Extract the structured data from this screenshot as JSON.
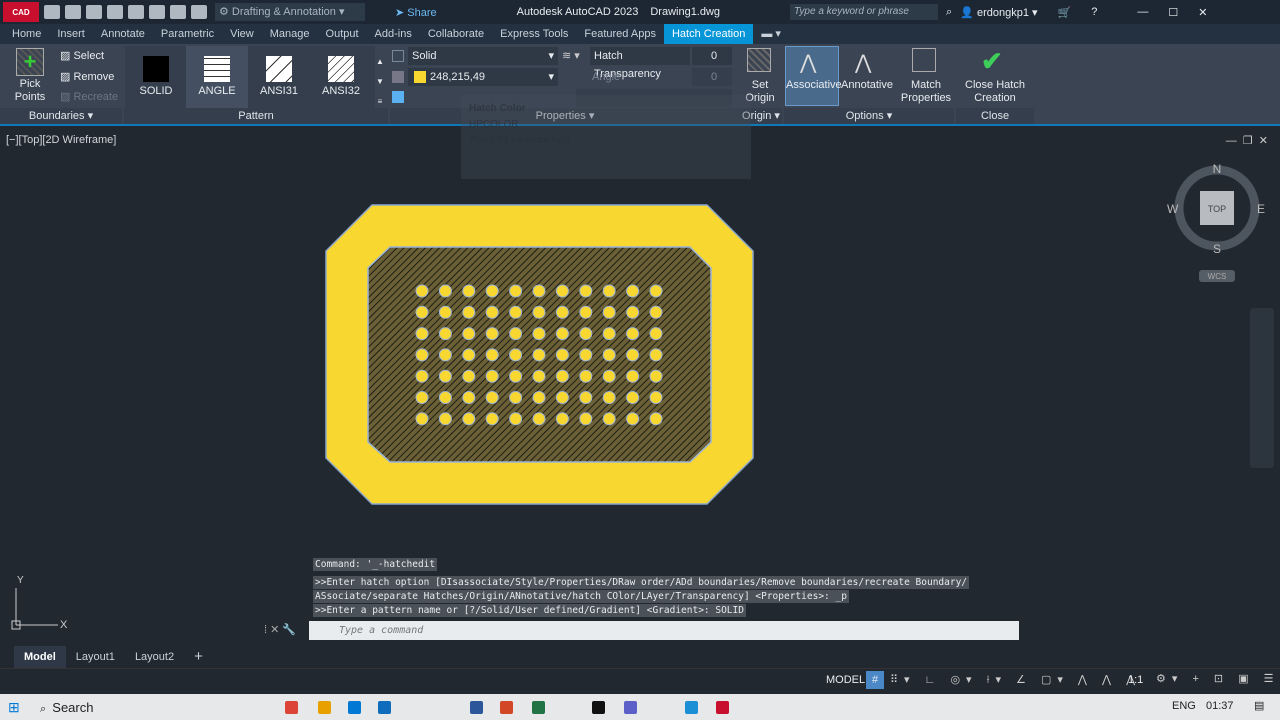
{
  "titlebar": {
    "app_badge": "CAD",
    "workspace": "Drafting & Annotation",
    "share": "Share",
    "title": "Autodesk AutoCAD 2023",
    "file": "Drawing1.dwg",
    "search_placeholder": "Type a keyword or phrase",
    "user": "erdongkp1"
  },
  "tabs": [
    "Home",
    "Insert",
    "Annotate",
    "Parametric",
    "View",
    "Manage",
    "Output",
    "Add-ins",
    "Collaborate",
    "Express Tools",
    "Featured Apps",
    "Hatch Creation"
  ],
  "ribbon": {
    "boundaries": {
      "pick_points": "Pick Points",
      "select": "Select",
      "remove": "Remove",
      "recreate": "Recreate",
      "label": "Boundaries"
    },
    "pattern": {
      "items": [
        "SOLID",
        "ANGLE",
        "ANSI31",
        "ANSI32"
      ],
      "label": "Pattern"
    },
    "properties": {
      "type": "Solid",
      "color": "248,215,49",
      "color_hex": "#f8d731",
      "transparency_label": "Hatch Transparency",
      "transparency": "0",
      "angle_label": "Angle",
      "angle": "0",
      "label": "Properties"
    },
    "origin": {
      "set_origin": "Set Origin",
      "label": "Origin"
    },
    "options": {
      "associative": "Associative",
      "annotative": "Annotative",
      "match": "Match Properties",
      "label": "Options"
    },
    "close": {
      "button": "Close Hatch Creation",
      "label": "Close"
    }
  },
  "tooltip": {
    "title": "Hatch Color",
    "command": "HPCOLOR",
    "help": "Press F1 for more help"
  },
  "viewport": {
    "label": "[−][Top][2D Wireframe]",
    "compass": {
      "n": "N",
      "s": "S",
      "e": "E",
      "w": "W",
      "top": "TOP"
    },
    "wcs": "WCS"
  },
  "commandline": {
    "history": [
      "Command: '_-hatchedit",
      ">>Enter hatch option [DIsassociate/Style/Properties/DRaw order/ADd boundaries/Remove boundaries/recreate Boundary/",
      "ASsociate/separate Hatches/Origin/ANnotative/hatch COlor/LAyer/Transparency] <Properties>: _p",
      ">>Enter a pattern name or [?/Solid/User defined/Gradient] <Gradient>: SOLID"
    ],
    "placeholder": "Type a command"
  },
  "layouts": [
    "Model",
    "Layout1",
    "Layout2",
    "+"
  ],
  "status": {
    "model": "MODEL",
    "scale": "1:1"
  },
  "taskbar": {
    "search": "Search",
    "lang": "ENG",
    "time": "01:37"
  },
  "colors": {
    "hatch": "#f8d731",
    "accent": "#0696d7"
  }
}
